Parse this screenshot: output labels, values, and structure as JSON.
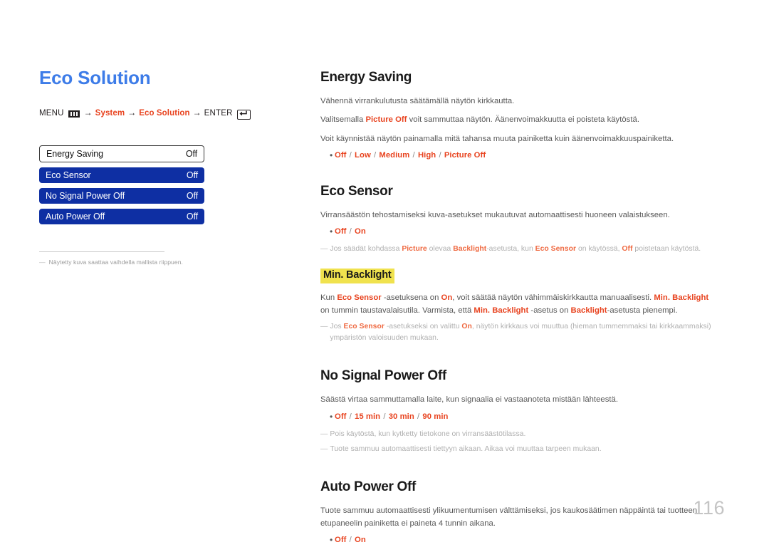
{
  "page": {
    "title": "Eco Solution",
    "number": "116"
  },
  "breadcrumb": {
    "menu_label": "MENU",
    "menu_icon": "menu-bars-icon",
    "arrow": "→",
    "step1": "System",
    "step2": "Eco Solution",
    "enter_label": "ENTER",
    "enter_icon": "enter-key-icon"
  },
  "osd": {
    "rows": [
      {
        "label": "Energy Saving",
        "value": "Off",
        "selected": true
      },
      {
        "label": "Eco Sensor",
        "value": "Off",
        "selected": false
      },
      {
        "label": "No Signal Power Off",
        "value": "Off",
        "selected": false
      },
      {
        "label": "Auto Power Off",
        "value": "Off",
        "selected": false
      }
    ],
    "note_dash": "―",
    "note": "Näytetty kuva saattaa vaihdella mallista riippuen."
  },
  "sections": {
    "energy_saving": {
      "heading": "Energy Saving",
      "p1": "Vähennä virrankulutusta säätämällä näytön kirkkautta.",
      "p2_a": "Valitsemalla ",
      "p2_b": "Picture Off",
      "p2_c": " voit sammuttaa näytön. Äänenvoimakkuutta ei poisteta käytöstä.",
      "p3": "Voit käynnistää näytön painamalla mitä tahansa muuta painiketta kuin äänenvoimakkuuspainiketta.",
      "bullet": "Off / Low / Medium / High / Picture Off",
      "bullet_parts": [
        "Off",
        "Low",
        "Medium",
        "High",
        "Picture Off"
      ]
    },
    "eco_sensor": {
      "heading": "Eco Sensor",
      "p1": "Virransäästön tehostamiseksi kuva-asetukset mukautuvat automaattisesti huoneen valaistukseen.",
      "bullet_parts": [
        "Off",
        "On"
      ],
      "note_a": "Jos säädät kohdassa ",
      "note_b": "Picture",
      "note_c": " olevaa ",
      "note_d": "Backlight",
      "note_e": "-asetusta, kun ",
      "note_f": "Eco Sensor",
      "note_g": " on käytössä, ",
      "note_h": "Off",
      "note_i": " poistetaan käytöstä."
    },
    "min_backlight": {
      "heading": "Min. Backlight",
      "p1_a": "Kun ",
      "p1_b": "Eco Sensor",
      "p1_c": " -asetuksena on ",
      "p1_d": "On",
      "p1_e": ", voit säätää näytön vähimmäiskirkkautta manuaalisesti. ",
      "p1_f": "Min. Backlight",
      "p1_g": " on tummin taustavalaisutila. Varmista, että ",
      "p1_h": "Min. Backlight",
      "p1_i": " -asetus on ",
      "p1_j": "Backlight",
      "p1_k": "-asetusta pienempi.",
      "note_a": "Jos ",
      "note_b": "Eco Sensor",
      "note_c": " -asetukseksi on valittu ",
      "note_d": "On",
      "note_e": ", näytön kirkkaus voi muuttua (hieman tummemmaksi tai kirkkaammaksi) ympäristön valoisuuden mukaan."
    },
    "no_signal_power_off": {
      "heading": "No Signal Power Off",
      "p1": "Säästä virtaa sammuttamalla laite, kun signaalia ei vastaanoteta mistään lähteestä.",
      "bullet_parts": [
        "Off",
        "15 min",
        "30 min",
        "90 min"
      ],
      "note1": "Pois käytöstä, kun kytketty tietokone on virransäästötilassa.",
      "note2": "Tuote sammuu automaattisesti tiettyyn aikaan. Aikaa voi muuttaa tarpeen mukaan."
    },
    "auto_power_off": {
      "heading": "Auto Power Off",
      "p1": "Tuote sammuu automaattisesti ylikuumentumisen välttämiseksi, jos kaukosäätimen näppäintä tai tuotteen etupaneelin painiketta ei paineta 4 tunnin aikana.",
      "bullet_parts": [
        "Off",
        "On"
      ]
    }
  },
  "colors": {
    "title_blue": "#3d7ce8",
    "osd_blue": "#0e2fa3",
    "accent_orange": "#e8431f",
    "highlight_yellow": "#f0e24e",
    "body_gray": "#575757",
    "note_gray": "#b0b0b0"
  }
}
